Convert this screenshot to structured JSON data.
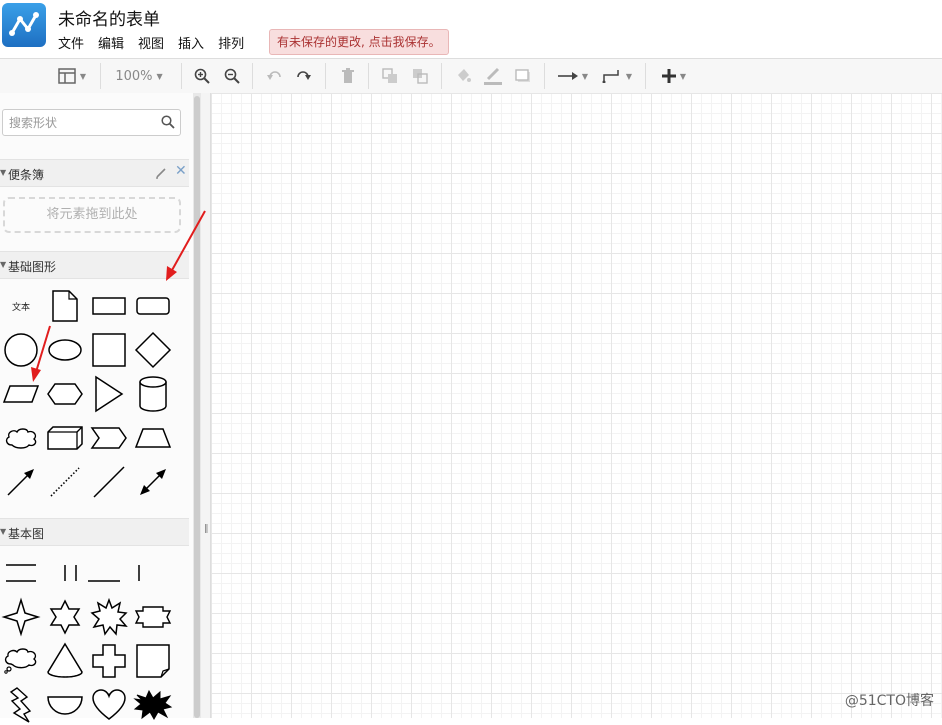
{
  "app": {
    "title": "未命名的表单",
    "unsaved_notice": "有未保存的更改, 点击我保存。"
  },
  "menu": [
    "文件",
    "编辑",
    "视图",
    "插入",
    "排列"
  ],
  "toolbar": {
    "zoom": "100%",
    "icons": [
      "layout-icon",
      "zoom-in-icon",
      "zoom-out-icon",
      "undo-icon",
      "redo-icon",
      "delete-icon",
      "to-front-icon",
      "to-back-icon",
      "fill-color-icon",
      "line-color-icon",
      "shadow-icon",
      "connection-icon",
      "waypoint-icon",
      "insert-icon"
    ]
  },
  "sidebar": {
    "search_placeholder": "搜索形状",
    "scratchpad": {
      "title": "便条簿",
      "drop_hint": "将元素拖到此处"
    },
    "basic_shapes": {
      "title": "基础图形",
      "text_shape": "文本"
    },
    "basic_diagram": {
      "title": "基本图"
    }
  },
  "watermark": "@51CTO博客",
  "colors": {
    "accent": "#1e6fc2",
    "notice_bg": "#f8dede",
    "annotation_arrow": "#e11d1d"
  }
}
